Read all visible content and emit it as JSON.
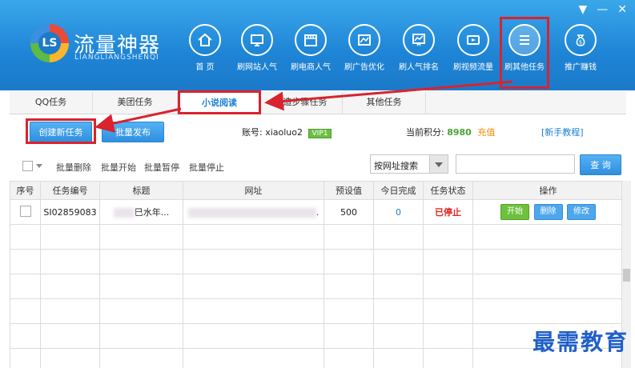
{
  "app": {
    "title": "流量神器",
    "subtitle": "LIANGLIANGSHENQI",
    "logo_text": "LS"
  },
  "window_controls": [
    "▼",
    "—",
    "✕"
  ],
  "nav": [
    {
      "label": "首  页",
      "icon": "home-icon"
    },
    {
      "label": "刷网站人气",
      "icon": "monitor-icon"
    },
    {
      "label": "刷电商人气",
      "icon": "shop-icon"
    },
    {
      "label": "刷广告优化",
      "icon": "ad-icon"
    },
    {
      "label": "刷人气排名",
      "icon": "chart-icon"
    },
    {
      "label": "刷视频流量",
      "icon": "video-icon"
    },
    {
      "label": "刷其他任务",
      "icon": "list-icon"
    },
    {
      "label": "推广赚钱",
      "icon": "money-bag-icon"
    }
  ],
  "tabs": [
    "QQ任务",
    "美团任务",
    "小说阅读",
    "制造步骤任务",
    "其他任务"
  ],
  "actions": {
    "create": "创建新任务",
    "batch_publish": "批量发布"
  },
  "account": {
    "label": "账号:",
    "name": "xiaoluo2",
    "vip": "VIP1"
  },
  "points": {
    "label": "当前积分:",
    "value": "8980",
    "recharge": "充值"
  },
  "tutorial": "[新手教程]",
  "toolbar": {
    "bulk": [
      "批量删除",
      "批量开始",
      "批量暂停",
      "批量停止"
    ],
    "search_by": "按网址搜索",
    "search_btn": "查 询",
    "search_placeholder": ""
  },
  "table": {
    "headers": [
      "序号",
      "任务编号",
      "标题",
      "网址",
      "预设值",
      "今日完成",
      "任务状态",
      "操作"
    ],
    "rows": [
      {
        "id": "SI02859083",
        "title": "巳水年...",
        "url": ".",
        "preset": "500",
        "today": "0",
        "status": "已停止",
        "ops": [
          "开始",
          "删除",
          "修改"
        ]
      }
    ]
  },
  "watermark": "最需教育",
  "colors": {
    "header": "#1e84d6",
    "highlight": "#d9232e",
    "accent": "#1a7fd4",
    "stop": "#e0241f"
  }
}
